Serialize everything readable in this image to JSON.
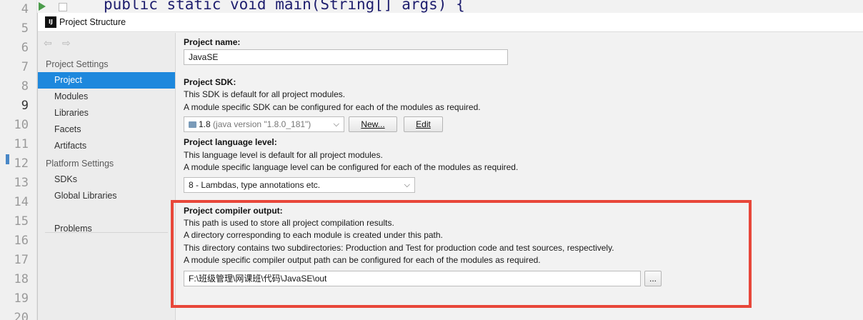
{
  "editor": {
    "line_numbers": [
      "4",
      "5",
      "6",
      "7",
      "8",
      "9",
      "10",
      "11",
      "12",
      "13",
      "14",
      "15",
      "16",
      "17",
      "18",
      "19",
      "20"
    ],
    "code_line": "public static void main(String[] args) {"
  },
  "dialog": {
    "title": "Project Structure",
    "app_icon_text": "IJ"
  },
  "sidebar": {
    "back_arrow": "⇦",
    "forward_arrow": "⇨",
    "project_settings_header": "Project Settings",
    "project_settings_items": [
      "Project",
      "Modules",
      "Libraries",
      "Facets",
      "Artifacts"
    ],
    "platform_settings_header": "Platform Settings",
    "platform_settings_items": [
      "SDKs",
      "Global Libraries"
    ],
    "problems": "Problems",
    "selected": "Project"
  },
  "project": {
    "name_label": "Project name:",
    "name_value": "JavaSE",
    "sdk_label": "Project SDK:",
    "sdk_desc1": "This SDK is default for all project modules.",
    "sdk_desc2": "A module specific SDK can be configured for each of the modules as required.",
    "sdk_value": "1.8",
    "sdk_version": "(java version \"1.8.0_181\")",
    "new_button": "New...",
    "edit_button": "Edit",
    "language_label": "Project language level:",
    "language_desc1": "This language level is default for all project modules.",
    "language_desc2": "A module specific language level can be configured for each of the modules as required.",
    "language_value": "8 - Lambdas, type annotations etc.",
    "compiler_label": "Project compiler output:",
    "compiler_desc1": "This path is used to store all project compilation results.",
    "compiler_desc2": "A directory corresponding to each module is created under this path.",
    "compiler_desc3": "This directory contains two subdirectories: Production and Test for production code and test sources, respectively.",
    "compiler_desc4": "A module specific compiler output path can be configured for each of the modules as required.",
    "compiler_path": "F:\\班级管理\\网课班\\代码\\JavaSE\\out",
    "browse_button": "..."
  },
  "colors": {
    "selection": "#1e88dd",
    "highlight_border": "#e8473a"
  }
}
